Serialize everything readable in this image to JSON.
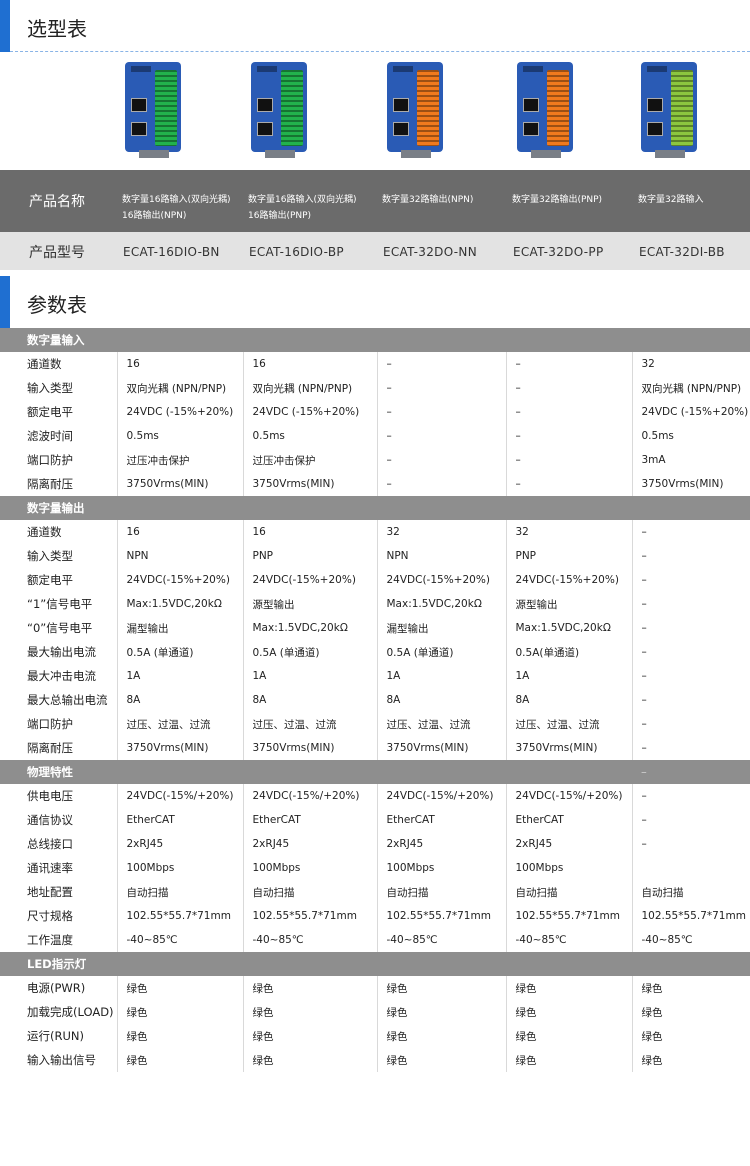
{
  "selection": {
    "title": "选型表",
    "name_label": "产品名称",
    "model_label": "产品型号",
    "products": [
      {
        "name_line1": "数字量16路输入(双向光耦)",
        "name_line2": "16路输出(NPN)",
        "model": "ECAT-16DIO-BN",
        "theme": "#f07a1e",
        "terminal": "#22b24c"
      },
      {
        "name_line1": "数字量16路输入(双向光耦)",
        "name_line2": "16路输出(PNP)",
        "model": "ECAT-16DIO-BP",
        "theme": "#f07a1e",
        "terminal": "#22b24c"
      },
      {
        "name_line1": "数字量32路输出(NPN)",
        "name_line2": "",
        "model": "ECAT-32DO-NN",
        "theme": "#f07a1e",
        "terminal": "#f07a1e"
      },
      {
        "name_line1": "数字量32路输出(PNP)",
        "name_line2": "",
        "model": "ECAT-32DO-PP",
        "theme": "#f07a1e",
        "terminal": "#f07a1e"
      },
      {
        "name_line1": "数字量32路输入",
        "name_line2": "",
        "model": "ECAT-32DI-BB",
        "theme": "#8cc63f",
        "terminal": "#8cc63f"
      }
    ]
  },
  "params": {
    "title": "参数表",
    "sections": [
      {
        "title": "数字量输入",
        "header_cells": [
          "",
          "",
          "",
          "",
          ""
        ],
        "rows": [
          {
            "label": "通道数",
            "cells": [
              "16",
              "16",
              "–",
              "–",
              "32"
            ]
          },
          {
            "label": "输入类型",
            "cells": [
              "双向光耦 (NPN/PNP)",
              "双向光耦 (NPN/PNP)",
              "–",
              "–",
              "双向光耦 (NPN/PNP)"
            ]
          },
          {
            "label": "额定电平",
            "cells": [
              "24VDC (-15%+20%)",
              "24VDC (-15%+20%)",
              "–",
              "–",
              "24VDC (-15%+20%)"
            ]
          },
          {
            "label": "滤波时间",
            "cells": [
              "0.5ms",
              "0.5ms",
              "–",
              "–",
              "0.5ms"
            ]
          },
          {
            "label": "端口防护",
            "cells": [
              "过压冲击保护",
              "过压冲击保护",
              "–",
              "–",
              "3mA"
            ]
          },
          {
            "label": "隔离耐压",
            "cells": [
              "3750Vrms(MIN)",
              "3750Vrms(MIN)",
              "–",
              "–",
              "3750Vrms(MIN)"
            ]
          }
        ]
      },
      {
        "title": "数字量输出",
        "header_cells": [
          "",
          "",
          "",
          "",
          ""
        ],
        "rows": [
          {
            "label": "通道数",
            "cells": [
              "16",
              "16",
              "32",
              "32",
              "–"
            ]
          },
          {
            "label": "输入类型",
            "cells": [
              "NPN",
              "PNP",
              "NPN",
              "PNP",
              "–"
            ]
          },
          {
            "label": "额定电平",
            "cells": [
              "24VDC(-15%+20%)",
              "24VDC(-15%+20%)",
              "24VDC(-15%+20%)",
              "24VDC(-15%+20%)",
              "–"
            ]
          },
          {
            "label": "“1”信号电平",
            "cells": [
              "Max:1.5VDC,20kΩ",
              "源型输出",
              "Max:1.5VDC,20kΩ",
              "源型输出",
              "–"
            ]
          },
          {
            "label": "“0”信号电平",
            "cells": [
              "漏型输出",
              "Max:1.5VDC,20kΩ",
              "漏型输出",
              "Max:1.5VDC,20kΩ",
              "–"
            ]
          },
          {
            "label": "最大输出电流",
            "cells": [
              "0.5A (单通道)",
              "0.5A (单通道)",
              "0.5A (单通道)",
              "0.5A(单通道)",
              "–"
            ]
          },
          {
            "label": "最大冲击电流",
            "cells": [
              "1A",
              "1A",
              "1A",
              "1A",
              "–"
            ]
          },
          {
            "label": "最大总输出电流",
            "cells": [
              "8A",
              "8A",
              "8A",
              "8A",
              "–"
            ]
          },
          {
            "label": "端口防护",
            "cells": [
              "过压、过温、过流",
              "过压、过温、过流",
              "过压、过温、过流",
              "过压、过温、过流",
              "–"
            ]
          },
          {
            "label": "隔离耐压",
            "cells": [
              "3750Vrms(MIN)",
              "3750Vrms(MIN)",
              "3750Vrms(MIN)",
              "3750Vrms(MIN)",
              "–"
            ]
          }
        ]
      },
      {
        "title": "物理特性",
        "header_cells": [
          "",
          "",
          "",
          "",
          "–"
        ],
        "rows": [
          {
            "label": "供电电压",
            "cells": [
              "24VDC(-15%/+20%)",
              "24VDC(-15%/+20%)",
              "24VDC(-15%/+20%)",
              "24VDC(-15%/+20%)",
              "–"
            ]
          },
          {
            "label": "通信协议",
            "cells": [
              "EtherCAT",
              "EtherCAT",
              "EtherCAT",
              "EtherCAT",
              "–"
            ]
          },
          {
            "label": "总线接口",
            "cells": [
              "2xRJ45",
              "2xRJ45",
              "2xRJ45",
              "2xRJ45",
              "–"
            ]
          },
          {
            "label": "通讯速率",
            "cells": [
              "100Mbps",
              "100Mbps",
              "100Mbps",
              "100Mbps",
              ""
            ]
          },
          {
            "label": "地址配置",
            "cells": [
              "自动扫描",
              "自动扫描",
              "自动扫描",
              "自动扫描",
              "自动扫描"
            ]
          },
          {
            "label": "尺寸规格",
            "cells": [
              "102.55*55.7*71mm",
              "102.55*55.7*71mm",
              "102.55*55.7*71mm",
              "102.55*55.7*71mm",
              "102.55*55.7*71mm"
            ]
          },
          {
            "label": "工作温度",
            "cells": [
              "-40~85℃",
              "-40~85℃",
              "-40~85℃",
              "-40~85℃",
              "-40~85℃"
            ]
          }
        ]
      },
      {
        "title": "LED指示灯",
        "header_cells": [
          "",
          "",
          "",
          "",
          ""
        ],
        "rows": [
          {
            "label": "电源(PWR)",
            "cells": [
              "绿色",
              "绿色",
              "绿色",
              "绿色",
              "绿色"
            ]
          },
          {
            "label": "加载完成(LOAD)",
            "cells": [
              "绿色",
              "绿色",
              "绿色",
              "绿色",
              "绿色"
            ]
          },
          {
            "label": "运行(RUN)",
            "cells": [
              "绿色",
              "绿色",
              "绿色",
              "绿色",
              "绿色"
            ]
          },
          {
            "label": "输入输出信号",
            "cells": [
              "绿色",
              "绿色",
              "绿色",
              "绿色",
              "绿色"
            ]
          }
        ]
      }
    ]
  },
  "colors": {
    "accent": "#1f6fd1",
    "name_bar": "#6b6b6b",
    "model_bar": "#e3e3e3",
    "category_bar": "#8e8e8e",
    "module_body": "#2a5bb5"
  }
}
